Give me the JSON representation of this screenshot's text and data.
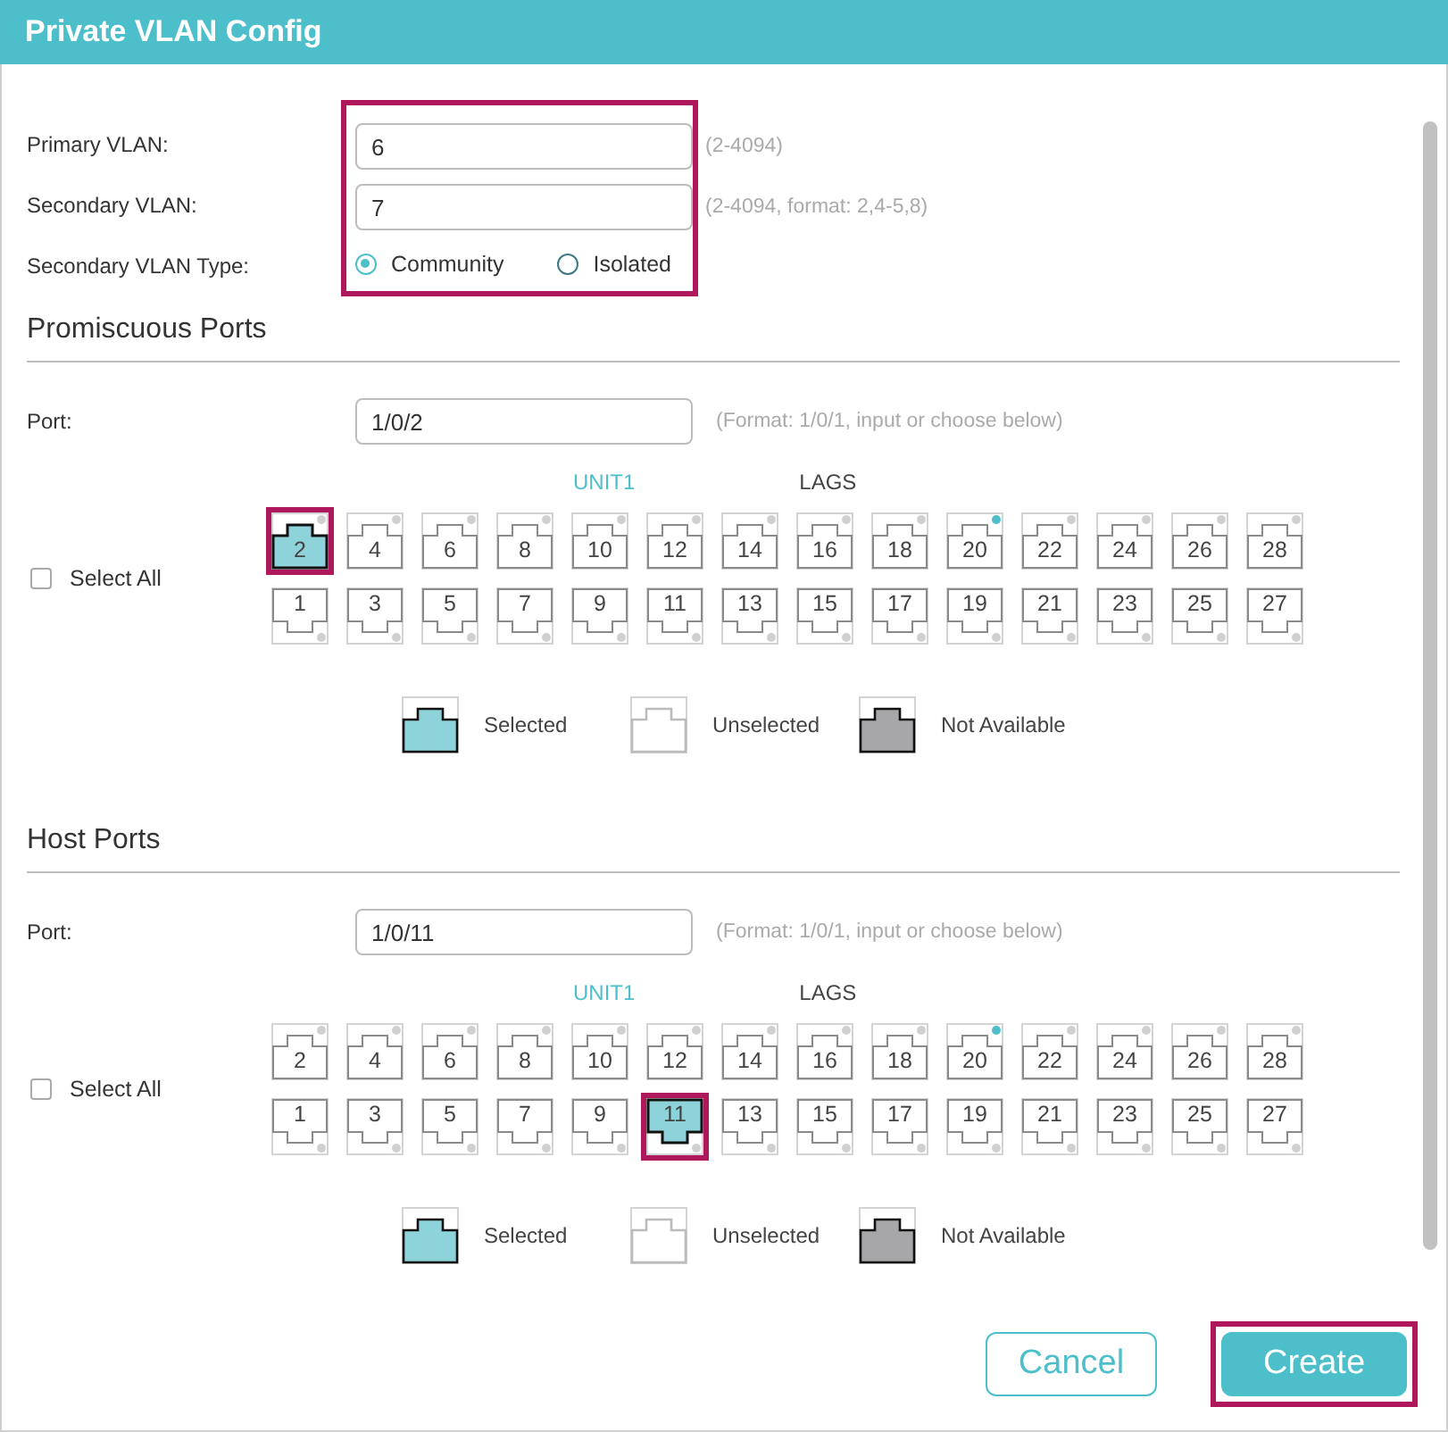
{
  "window": {
    "title": "Private VLAN Config"
  },
  "vlan_form": {
    "highlighted": true,
    "primary_vlan": {
      "label": "Primary VLAN:",
      "value": "6",
      "hint": "(2-4094)"
    },
    "secondary_vlan": {
      "label": "Secondary VLAN:",
      "value": "7",
      "hint": "(2-4094, format: 2,4-5,8)"
    },
    "secondary_vlan_type": {
      "label": "Secondary VLAN Type:",
      "options": [
        {
          "label": "Community",
          "selected": true
        },
        {
          "label": "Isolated",
          "selected": false
        }
      ]
    }
  },
  "sections": [
    {
      "title": "Promiscuous Ports",
      "port": {
        "label": "Port:",
        "value": "1/0/2",
        "hint": "(Format: 1/0/1, input or choose below)"
      },
      "tabs": [
        {
          "label": "UNIT1",
          "selected": true
        },
        {
          "label": "LAGS",
          "selected": false
        }
      ],
      "select_all": {
        "label": "Select All",
        "checked": false
      },
      "top_ports": [
        {
          "label": "2",
          "selected": true,
          "highlighted": true,
          "link": false
        },
        {
          "label": "4",
          "selected": false,
          "highlighted": false,
          "link": false
        },
        {
          "label": "6",
          "selected": false,
          "highlighted": false,
          "link": false
        },
        {
          "label": "8",
          "selected": false,
          "highlighted": false,
          "link": false
        },
        {
          "label": "10",
          "selected": false,
          "highlighted": false,
          "link": false
        },
        {
          "label": "12",
          "selected": false,
          "highlighted": false,
          "link": false
        },
        {
          "label": "14",
          "selected": false,
          "highlighted": false,
          "link": false
        },
        {
          "label": "16",
          "selected": false,
          "highlighted": false,
          "link": false
        },
        {
          "label": "18",
          "selected": false,
          "highlighted": false,
          "link": false
        },
        {
          "label": "20",
          "selected": false,
          "highlighted": false,
          "link": true
        },
        {
          "label": "22",
          "selected": false,
          "highlighted": false,
          "link": false
        },
        {
          "label": "24",
          "selected": false,
          "highlighted": false,
          "link": false
        },
        {
          "label": "26",
          "selected": false,
          "highlighted": false,
          "link": false
        },
        {
          "label": "28",
          "selected": false,
          "highlighted": false,
          "link": false
        }
      ],
      "bottom_ports": [
        {
          "label": "1",
          "selected": false,
          "highlighted": false,
          "link": false
        },
        {
          "label": "3",
          "selected": false,
          "highlighted": false,
          "link": false
        },
        {
          "label": "5",
          "selected": false,
          "highlighted": false,
          "link": false
        },
        {
          "label": "7",
          "selected": false,
          "highlighted": false,
          "link": false
        },
        {
          "label": "9",
          "selected": false,
          "highlighted": false,
          "link": false
        },
        {
          "label": "11",
          "selected": false,
          "highlighted": false,
          "link": false
        },
        {
          "label": "13",
          "selected": false,
          "highlighted": false,
          "link": false
        },
        {
          "label": "15",
          "selected": false,
          "highlighted": false,
          "link": false
        },
        {
          "label": "17",
          "selected": false,
          "highlighted": false,
          "link": false
        },
        {
          "label": "19",
          "selected": false,
          "highlighted": false,
          "link": false
        },
        {
          "label": "21",
          "selected": false,
          "highlighted": false,
          "link": false
        },
        {
          "label": "23",
          "selected": false,
          "highlighted": false,
          "link": false
        },
        {
          "label": "25",
          "selected": false,
          "highlighted": false,
          "link": false
        },
        {
          "label": "27",
          "selected": false,
          "highlighted": false,
          "link": false
        }
      ],
      "legend": [
        {
          "kind": "selected",
          "label": "Selected"
        },
        {
          "kind": "unselected",
          "label": "Unselected"
        },
        {
          "kind": "unavailable",
          "label": "Not Available"
        }
      ]
    },
    {
      "title": "Host Ports",
      "port": {
        "label": "Port:",
        "value": "1/0/11",
        "hint": "(Format: 1/0/1, input or choose below)"
      },
      "tabs": [
        {
          "label": "UNIT1",
          "selected": true
        },
        {
          "label": "LAGS",
          "selected": false
        }
      ],
      "select_all": {
        "label": "Select All",
        "checked": false
      },
      "top_ports": [
        {
          "label": "2",
          "selected": false,
          "highlighted": false,
          "link": false
        },
        {
          "label": "4",
          "selected": false,
          "highlighted": false,
          "link": false
        },
        {
          "label": "6",
          "selected": false,
          "highlighted": false,
          "link": false
        },
        {
          "label": "8",
          "selected": false,
          "highlighted": false,
          "link": false
        },
        {
          "label": "10",
          "selected": false,
          "highlighted": false,
          "link": false
        },
        {
          "label": "12",
          "selected": false,
          "highlighted": false,
          "link": false
        },
        {
          "label": "14",
          "selected": false,
          "highlighted": false,
          "link": false
        },
        {
          "label": "16",
          "selected": false,
          "highlighted": false,
          "link": false
        },
        {
          "label": "18",
          "selected": false,
          "highlighted": false,
          "link": false
        },
        {
          "label": "20",
          "selected": false,
          "highlighted": false,
          "link": true
        },
        {
          "label": "22",
          "selected": false,
          "highlighted": false,
          "link": false
        },
        {
          "label": "24",
          "selected": false,
          "highlighted": false,
          "link": false
        },
        {
          "label": "26",
          "selected": false,
          "highlighted": false,
          "link": false
        },
        {
          "label": "28",
          "selected": false,
          "highlighted": false,
          "link": false
        }
      ],
      "bottom_ports": [
        {
          "label": "1",
          "selected": false,
          "highlighted": false,
          "link": false
        },
        {
          "label": "3",
          "selected": false,
          "highlighted": false,
          "link": false
        },
        {
          "label": "5",
          "selected": false,
          "highlighted": false,
          "link": false
        },
        {
          "label": "7",
          "selected": false,
          "highlighted": false,
          "link": false
        },
        {
          "label": "9",
          "selected": false,
          "highlighted": false,
          "link": false
        },
        {
          "label": "11",
          "selected": true,
          "highlighted": true,
          "link": false
        },
        {
          "label": "13",
          "selected": false,
          "highlighted": false,
          "link": false
        },
        {
          "label": "15",
          "selected": false,
          "highlighted": false,
          "link": false
        },
        {
          "label": "17",
          "selected": false,
          "highlighted": false,
          "link": false
        },
        {
          "label": "19",
          "selected": false,
          "highlighted": false,
          "link": false
        },
        {
          "label": "21",
          "selected": false,
          "highlighted": false,
          "link": false
        },
        {
          "label": "23",
          "selected": false,
          "highlighted": false,
          "link": false
        },
        {
          "label": "25",
          "selected": false,
          "highlighted": false,
          "link": false
        },
        {
          "label": "27",
          "selected": false,
          "highlighted": false,
          "link": false
        }
      ],
      "legend": [
        {
          "kind": "selected",
          "label": "Selected"
        },
        {
          "kind": "unselected",
          "label": "Unselected"
        },
        {
          "kind": "unavailable",
          "label": "Not Available"
        }
      ]
    }
  ],
  "buttons": [
    {
      "kind": "secondary",
      "label": "Cancel",
      "highlighted": false
    },
    {
      "kind": "primary",
      "label": "Create",
      "highlighted": true
    }
  ]
}
